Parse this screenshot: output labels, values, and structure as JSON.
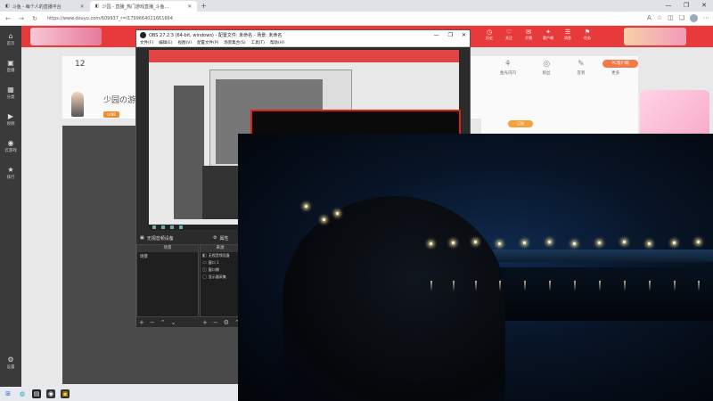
{
  "browser": {
    "tabs": [
      {
        "label": "斗鱼 - 每个人的直播平台",
        "active": false
      },
      {
        "label": "少园 - 直播_热门游戏直播_斗鱼...",
        "active": true
      }
    ],
    "url": "https://www.douyu.com/609937_r=l1799664021661664",
    "window_controls": [
      "—",
      "❐",
      "✕"
    ]
  },
  "site": {
    "rail": [
      {
        "icon": "home-icon",
        "glyph": "⌂",
        "label": "首页"
      },
      {
        "icon": "live-icon",
        "glyph": "▣",
        "label": "直播"
      },
      {
        "icon": "category-icon",
        "glyph": "▦",
        "label": "分类"
      },
      {
        "icon": "video-icon",
        "glyph": "▶",
        "label": "视频"
      },
      {
        "icon": "game-icon",
        "glyph": "◉",
        "label": "云游戏"
      },
      {
        "icon": "ranking-icon",
        "glyph": "★",
        "label": "排行"
      }
    ],
    "rail_bottom": {
      "glyph": "⚙",
      "label": "设置"
    },
    "header_icons": [
      {
        "glyph": "◷",
        "label": "历史"
      },
      {
        "glyph": "♡",
        "label": "关注"
      },
      {
        "glyph": "✉",
        "label": "开播"
      },
      {
        "glyph": "✦",
        "label": "客户端"
      },
      {
        "glyph": "☰",
        "label": "消息"
      },
      {
        "glyph": "⚑",
        "label": "任务"
      }
    ],
    "room_count": "12",
    "room_title": "少园の游戏",
    "room_badge": "LV88",
    "right_panel_row1": [
      {
        "glyph": "⚘",
        "label": "金光闪闪"
      },
      {
        "glyph": "◎",
        "label": "粉丝"
      },
      {
        "glyph": "✎",
        "label": "签到"
      },
      {
        "glyph": "⊙",
        "label": "更多"
      }
    ],
    "pc_client": "PC客户端",
    "orange_button": "订阅"
  },
  "obs": {
    "title": "OBS 27.2.3 (64-bit, windows) - 配置文件: 未命名 - 场景: 未命名",
    "menu": [
      "文件(F)",
      "编辑(E)",
      "视图(V)",
      "配置文件(P)",
      "场景集合(S)",
      "工具(T)",
      "帮助(H)"
    ],
    "scenes_dock_title": "无视音频设备",
    "sources_dock_title": "属性",
    "scenes_header": "场景",
    "sources_header": "来源",
    "scene_items": [
      "场景"
    ],
    "source_items": [
      {
        "glyph": "◧",
        "label": "无视音频设备"
      },
      {
        "glyph": "▭",
        "label": "窗口 1"
      },
      {
        "glyph": "◫",
        "label": "窗口捕"
      },
      {
        "glyph": "▢",
        "label": "显示器采集"
      }
    ],
    "dock_buttons": [
      "+",
      "−",
      "⌃",
      "⌄"
    ]
  },
  "taskbar": {
    "icons": [
      {
        "name": "windows-start-icon",
        "glyph": "⊞"
      },
      {
        "name": "edge-icon",
        "glyph": "◍"
      },
      {
        "name": "file-explorer-icon",
        "glyph": "▤"
      },
      {
        "name": "obs-icon",
        "glyph": "◉"
      },
      {
        "name": "app-icon",
        "glyph": "▣"
      }
    ]
  }
}
